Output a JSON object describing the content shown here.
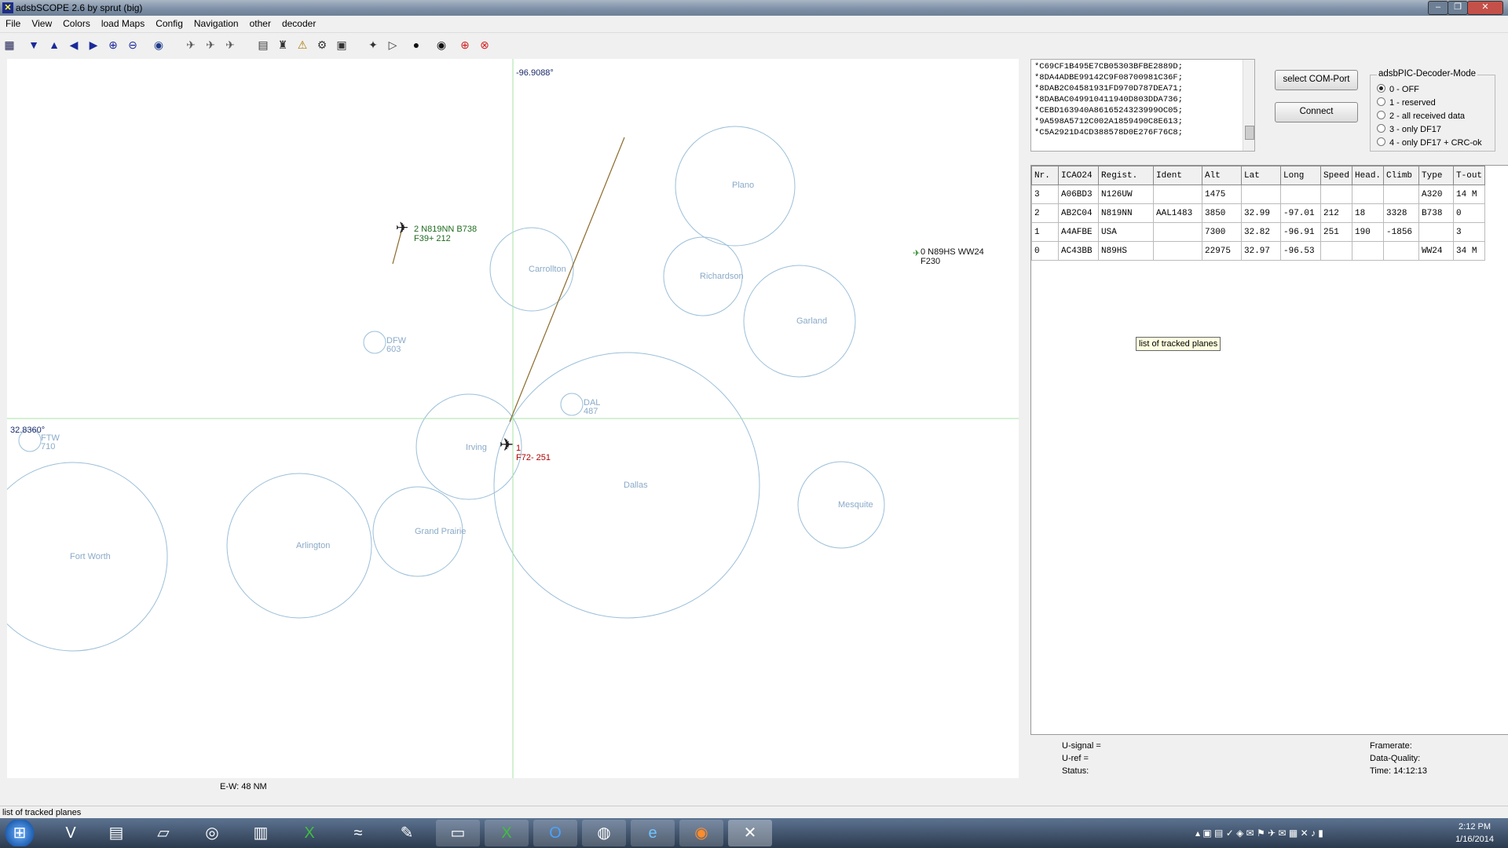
{
  "window": {
    "title": "adsbSCOPE 2.6 by sprut  (big)"
  },
  "menu": [
    "File",
    "View",
    "Colors",
    "load Maps",
    "Config",
    "Navigation",
    "other",
    "decoder"
  ],
  "map": {
    "lon_label": "-96.9088°",
    "lat_label": "32.8360°",
    "scale_label": "E-W: 48 NM",
    "cities": [
      "Plano",
      "Carrollton",
      "Richardson",
      "Garland",
      "Irving",
      "Dallas",
      "Mesquite",
      "Fort Worth",
      "Arlington",
      "Grand Prairie"
    ],
    "airports": [
      {
        "code": "DFW",
        "elev": "603"
      },
      {
        "code": "DAL",
        "elev": "487"
      },
      {
        "code": "FTW",
        "elev": "710"
      }
    ],
    "planes": [
      {
        "line1": "2  N819NN  B738",
        "line2": "F39+  212"
      },
      {
        "line1": "1",
        "line2": "F72-  251"
      },
      {
        "line1": "0  N89HS  WW24",
        "line2": "F230"
      }
    ]
  },
  "raw_messages": [
    "*C69CF1B495E7CB05303BFBE2889D;",
    "*8DA4ADBE99142C9F08700981C36F;",
    "*8DAB2C04581931FD970D787DEA71;",
    "*8DABAC049910411940D803DDA736;",
    "*CEBD163940A8616524323999OC05;",
    "*9A598A5712C002A1859490C8E613;",
    "*C5A2921D4CD388578D0E276F76C8;"
  ],
  "buttons": {
    "com_port": "select COM-Port",
    "connect": "Connect"
  },
  "decoder_mode": {
    "legend": "adsbPIC-Decoder-Mode",
    "selected": 0,
    "options": [
      "0 - OFF",
      "1 - reserved",
      "2 - all received data",
      "3 - only DF17",
      "4 - only DF17 + CRC-ok"
    ]
  },
  "table": {
    "headers": [
      "Nr.",
      "ICAO24",
      "Regist.",
      "Ident",
      "Alt",
      "Lat",
      "Long",
      "Speed",
      "Head.",
      "Climb",
      "Type",
      "T-out"
    ],
    "rows": [
      [
        "3",
        "A06BD3",
        "N126UW",
        "",
        "1475",
        "",
        "",
        "",
        "",
        "",
        "A320",
        "14 M"
      ],
      [
        "2",
        "AB2C04",
        "N819NN",
        "AAL1483",
        "3850",
        "32.99",
        "-97.01",
        "212",
        "18",
        "3328",
        "B738",
        "0"
      ],
      [
        "1",
        "A4AFBE",
        "USA",
        "",
        "7300",
        "32.82",
        "-96.91",
        "251",
        "190",
        "-1856",
        "",
        "3"
      ],
      [
        "0",
        "AC43BB",
        "N89HS",
        "",
        "22975",
        "32.97",
        "-96.53",
        "",
        "",
        "",
        "WW24",
        "34 M"
      ]
    ]
  },
  "tooltip": "list of tracked planes",
  "status": {
    "u_signal": "U-signal =",
    "u_ref": "U-ref =",
    "status": "Status:",
    "framerate": "Framerate:",
    "data_quality": "Data-Quality:",
    "time": "Time: 14:12:13"
  },
  "statusbar": "list of tracked planes",
  "clock": {
    "time": "2:12 PM",
    "date": "1/16/2014"
  }
}
